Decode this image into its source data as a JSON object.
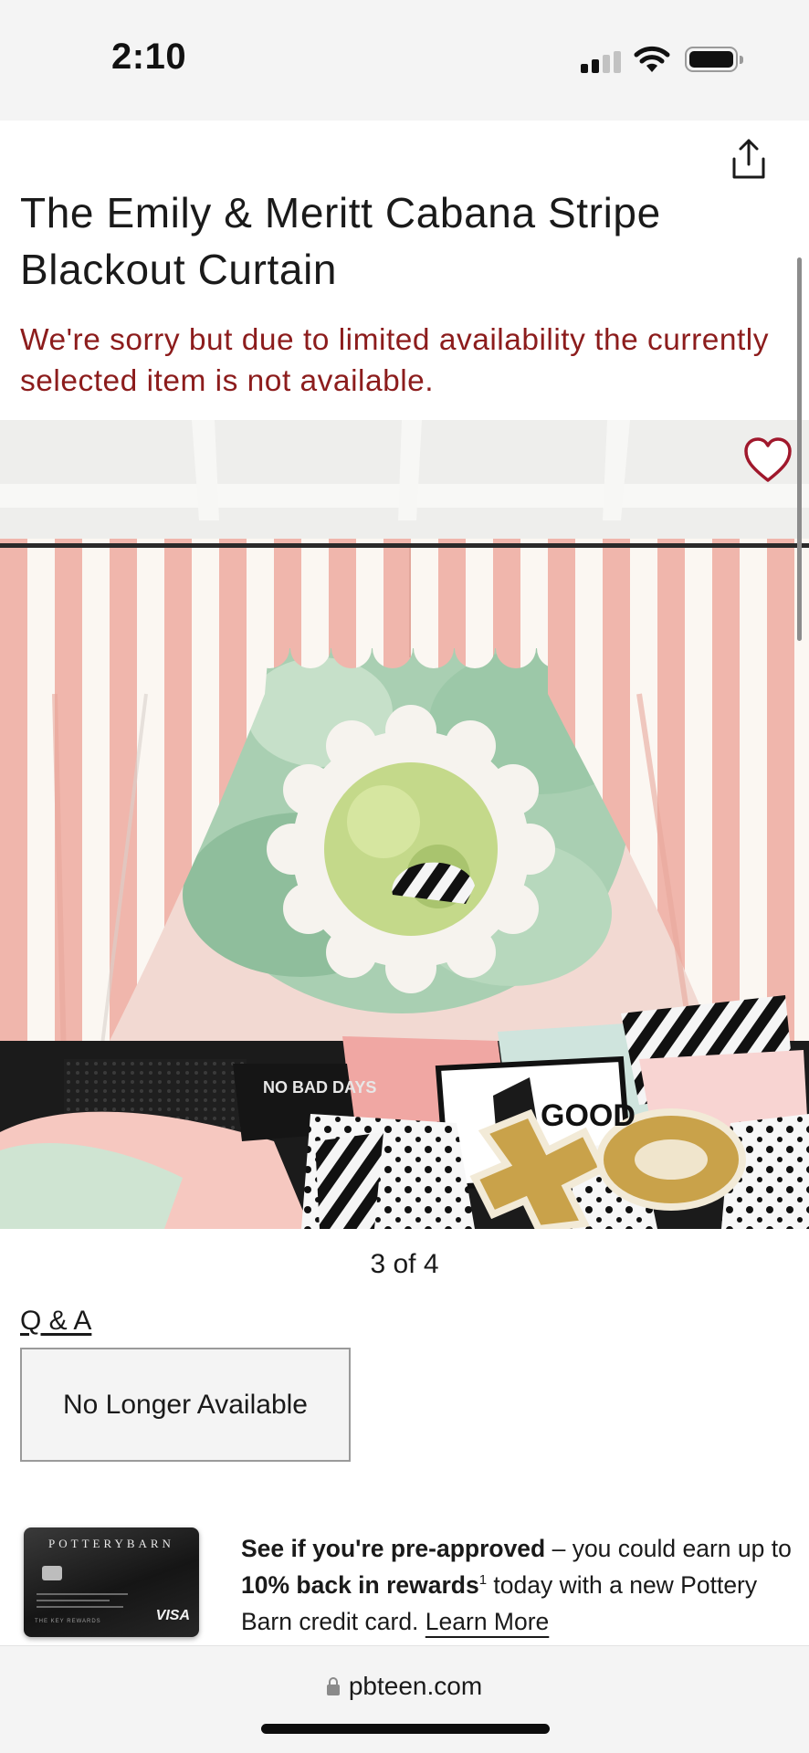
{
  "status_bar": {
    "time": "2:10"
  },
  "header": {
    "share_icon": "share-icon"
  },
  "product": {
    "title": "The Emily & Meritt Cabana Stripe Blackout Curtain",
    "warning": "We're sorry but due to limited availability the currently selected item is not available.",
    "image": {
      "counter": "3 of 4",
      "favorite_icon": "heart-outline-icon",
      "pillow_text_1": "NO BAD DAYS",
      "pillow_text_2": "GOOD",
      "pillow_text_3": "XO"
    },
    "qa_link": "Q & A",
    "availability_button": "No Longer Available"
  },
  "promo": {
    "card": {
      "brand": "POTTERYBARN",
      "network": "VISA",
      "program": "THE KEY REWARDS"
    },
    "bold_1": "See if you're pre-approved",
    "text_1": " – you could earn up to ",
    "bold_2": "10% back in rewards",
    "sup": "1",
    "text_2": " today with a new Pottery Barn credit card. ",
    "learn_more": "Learn More"
  },
  "browser": {
    "url": "pbteen.com"
  },
  "colors": {
    "warning_red": "#8c1c1c",
    "heart_red": "#a0182c",
    "stripe_pink": "#f0b6ac",
    "stripe_white": "#fbf7f2"
  }
}
